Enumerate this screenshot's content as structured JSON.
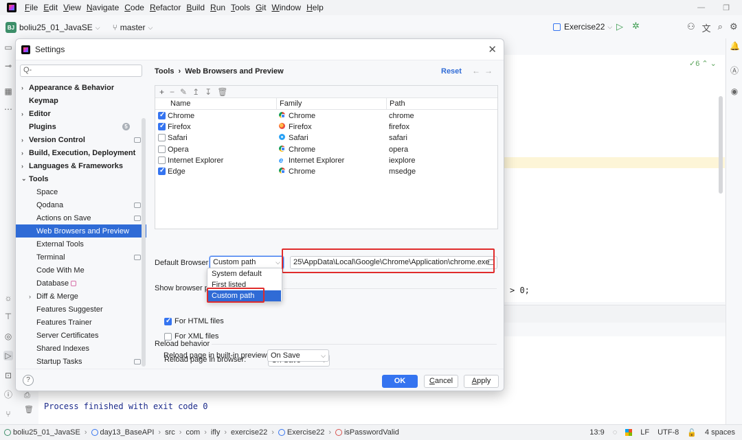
{
  "menubar": {
    "items": [
      "File",
      "Edit",
      "View",
      "Navigate",
      "Code",
      "Refactor",
      "Build",
      "Run",
      "Tools",
      "Git",
      "Window",
      "Help"
    ]
  },
  "toolbar": {
    "project_badge": "BJ",
    "project_name": "boliu25_01_JavaSE",
    "branch": "master",
    "run_config": "Exercise22"
  },
  "editor": {
    "code_fragment": "> 0;",
    "inspection_count": "6"
  },
  "console": {
    "output": "Process finished with exit code 0"
  },
  "statusbar": {
    "crumbs": [
      "boliu25_01_JavaSE",
      "day13_BaseAPI",
      "src",
      "com",
      "ifly",
      "exercise22",
      "Exercise22",
      "isPasswordValid"
    ],
    "position": "13:9",
    "line_separator": "LF",
    "encoding": "UTF-8",
    "indent": "4 spaces"
  },
  "settings": {
    "title": "Settings",
    "search_placeholder": "Q-",
    "tree": [
      {
        "label": "Appearance & Behavior",
        "bold": true,
        "arrow": "›",
        "indent": 0
      },
      {
        "label": "Keymap",
        "bold": true,
        "arrow": "",
        "indent": 0
      },
      {
        "label": "Editor",
        "bold": true,
        "arrow": "›",
        "indent": 0
      },
      {
        "label": "Plugins",
        "bold": true,
        "arrow": "",
        "indent": 0,
        "count": "5"
      },
      {
        "label": "Version Control",
        "bold": true,
        "arrow": "›",
        "indent": 0,
        "badge": true
      },
      {
        "label": "Build, Execution, Deployment",
        "bold": true,
        "arrow": "›",
        "indent": 0
      },
      {
        "label": "Languages & Frameworks",
        "bold": true,
        "arrow": "›",
        "indent": 0
      },
      {
        "label": "Tools",
        "bold": true,
        "arrow": "⌄",
        "indent": 0
      },
      {
        "label": "Space",
        "indent": 1
      },
      {
        "label": "Qodana",
        "indent": 1,
        "badge": true
      },
      {
        "label": "Actions on Save",
        "indent": 1,
        "badge": true
      },
      {
        "label": "Web Browsers and Preview",
        "indent": 1,
        "selected": true
      },
      {
        "label": "External Tools",
        "indent": 1
      },
      {
        "label": "Terminal",
        "indent": 1,
        "badge": true
      },
      {
        "label": "Code With Me",
        "indent": 1
      },
      {
        "label": "Database",
        "indent": 1,
        "lock": true
      },
      {
        "label": "Diff & Merge",
        "indent": 1,
        "arrow": "›"
      },
      {
        "label": "Features Suggester",
        "indent": 1
      },
      {
        "label": "Features Trainer",
        "indent": 1
      },
      {
        "label": "Server Certificates",
        "indent": 1
      },
      {
        "label": "Shared Indexes",
        "indent": 1
      },
      {
        "label": "Startup Tasks",
        "indent": 1,
        "badge": true
      }
    ],
    "breadcrumb": {
      "parent": "Tools",
      "sep": "›",
      "current": "Web Browsers and Preview"
    },
    "reset": "Reset",
    "table": {
      "toolbar_icons": [
        "+",
        "−",
        "✎",
        "↥",
        "↧",
        "🗑"
      ],
      "headers": [
        "Name",
        "Family",
        "Path"
      ],
      "rows": [
        {
          "checked": true,
          "name": "Chrome",
          "family": "Chrome",
          "family_icon": "chrome",
          "path": "chrome"
        },
        {
          "checked": true,
          "name": "Firefox",
          "family": "Firefox",
          "family_icon": "firefox",
          "path": "firefox"
        },
        {
          "checked": false,
          "name": "Safari",
          "family": "Safari",
          "family_icon": "safari",
          "path": "safari"
        },
        {
          "checked": false,
          "name": "Opera",
          "family": "Chrome",
          "family_icon": "chrome",
          "path": "opera"
        },
        {
          "checked": false,
          "name": "Internet Explorer",
          "family": "Internet Explorer",
          "family_icon": "ie",
          "path": "iexplore"
        },
        {
          "checked": true,
          "name": "Edge",
          "family": "Chrome",
          "family_icon": "chrome",
          "path": "msedge"
        }
      ]
    },
    "default_browser": {
      "label": "Default Browser:",
      "selected": "Custom path",
      "options": [
        "System default",
        "First listed",
        "Custom path"
      ],
      "path_value": "25\\AppData\\Local\\Google\\Chrome\\Application\\chrome.exe"
    },
    "show_browser": {
      "label": "Show browser p",
      "html_label": "For HTML files",
      "html_checked": true,
      "xml_label": "For XML files",
      "xml_checked": false
    },
    "reload": {
      "label": "Reload behavior",
      "browser_label": "Reload page in browser:",
      "browser_value": "On Save",
      "preview_label": "Reload page in built-in preview:",
      "preview_value": "On Save"
    },
    "buttons": {
      "help": "?",
      "ok": "OK",
      "cancel": "Cancel",
      "apply": "Apply"
    }
  },
  "colors": {
    "accent": "#3574f0",
    "selection": "#2f6bd6",
    "annotation_red": "#e02b2b"
  }
}
